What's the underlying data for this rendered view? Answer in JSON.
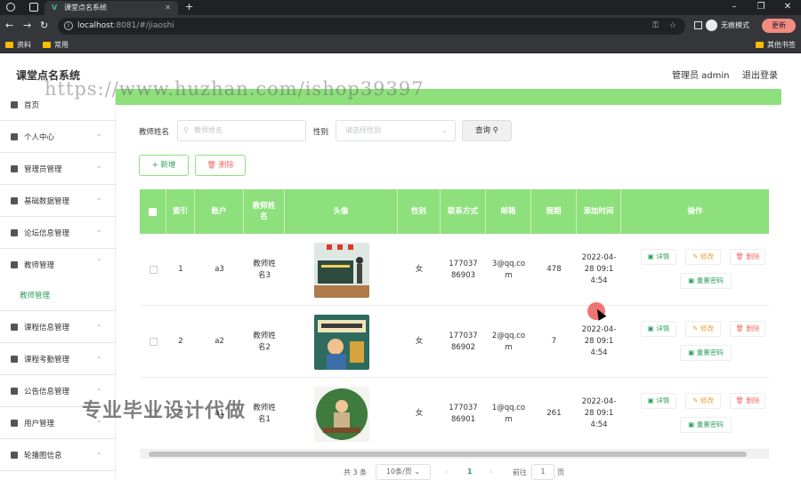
{
  "browser": {
    "tab_title": "课堂点名系统",
    "tab_icon": "V",
    "new_tab": "+",
    "url_host": "localhost",
    "url_path": ":8081/#/jiaoshi",
    "incognito_label": "无痕模式",
    "update_label": "更新",
    "bookmarks": [
      "资料",
      "常用"
    ],
    "bookmarks_right": "其他书签"
  },
  "header": {
    "title": "课堂点名系统",
    "admin": "管理员 admin",
    "logout": "退出登录"
  },
  "watermark": "https://www.huzhan.com/ishop39397",
  "overlay_text": "专业毕业设计代做",
  "sidebar": {
    "items": [
      {
        "label": "首页",
        "icon": "home-icon"
      },
      {
        "label": "个人中心",
        "icon": "user-icon"
      },
      {
        "label": "管理员管理",
        "icon": "admin-icon"
      },
      {
        "label": "基础数据管理",
        "icon": "data-icon"
      },
      {
        "label": "论坛信息管理",
        "icon": "forum-icon"
      },
      {
        "label": "教师管理",
        "icon": "teacher-icon"
      },
      {
        "label": "课程信息管理",
        "icon": "course-icon"
      },
      {
        "label": "课程考勤管理",
        "icon": "attendance-icon"
      },
      {
        "label": "公告信息管理",
        "icon": "notice-icon"
      },
      {
        "label": "用户管理",
        "icon": "users-icon"
      },
      {
        "label": "轮播图信息",
        "icon": "carousel-icon"
      }
    ],
    "active_sub": "教师管理"
  },
  "search": {
    "name_label": "教师姓名",
    "name_placeholder": "教师姓名",
    "gender_label": "性别",
    "gender_placeholder": "请选择性别",
    "query_button": "查询"
  },
  "actions": {
    "add": "+ 新增",
    "delete": "删除"
  },
  "table": {
    "headers": [
      "索引",
      "账户",
      "教师姓名",
      "头像",
      "性别",
      "联系方式",
      "邮箱",
      "假期",
      "添加时间",
      "操作"
    ],
    "rows": [
      {
        "index": "1",
        "account": "a3",
        "name": "教师姓名3",
        "gender": "女",
        "phone": "17703786903",
        "email": "3@qq.com",
        "holiday": "478",
        "time": "2022-04-28 09:14:54"
      },
      {
        "index": "2",
        "account": "a2",
        "name": "教师姓名2",
        "gender": "女",
        "phone": "17703786902",
        "email": "2@qq.com",
        "holiday": "7",
        "time": "2022-04-28 09:14:54"
      },
      {
        "index": "3",
        "account": "a1",
        "name": "教师姓名1",
        "gender": "女",
        "phone": "17703786901",
        "email": "1@qq.com",
        "holiday": "261",
        "time": "2022-04-28 09:14:54"
      }
    ],
    "row_actions": {
      "detail": "详情",
      "edit": "修改",
      "delete": "删除",
      "reset": "重置密码"
    }
  },
  "pagination": {
    "total": "共 3 条",
    "page_size": "10条/页",
    "prev": "‹",
    "current": "1",
    "next": "›",
    "goto_label": "前往",
    "goto_value": "1",
    "page_suffix": "页"
  }
}
